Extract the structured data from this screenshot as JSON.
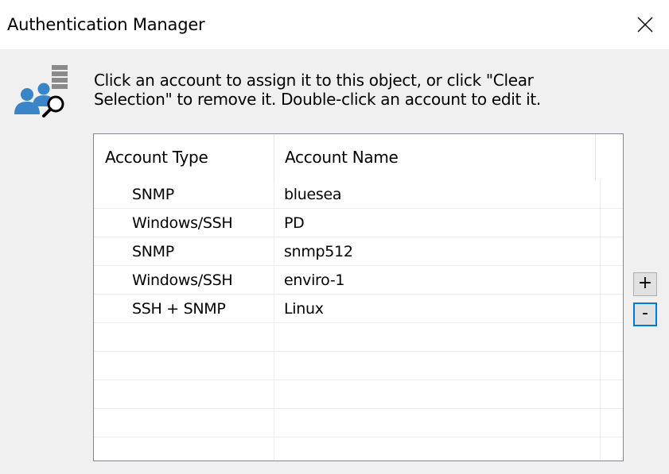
{
  "window": {
    "title": "Authentication Manager"
  },
  "instructions": {
    "line1": "Click an account to assign it to this object, or click \"Clear",
    "line2": "Selection\" to remove it. Double-click an account to edit it."
  },
  "table": {
    "columns": [
      "Account Type",
      "Account Name"
    ],
    "rows": [
      {
        "type": "SNMP",
        "name": "bluesea"
      },
      {
        "type": "Windows/SSH",
        "name": "PD"
      },
      {
        "type": "SNMP",
        "name": "snmp512"
      },
      {
        "type": "Windows/SSH",
        "name": "enviro-1"
      },
      {
        "type": "SSH + SNMP",
        "name": "Linux"
      }
    ]
  },
  "buttons": {
    "add_label": "+",
    "remove_label": "-"
  },
  "icons": {
    "app": "users-search-icon",
    "close": "close-icon"
  },
  "colors": {
    "accent": "#0078d7",
    "icon_blue": "#3a84c8",
    "background": "#f0f0f0"
  }
}
